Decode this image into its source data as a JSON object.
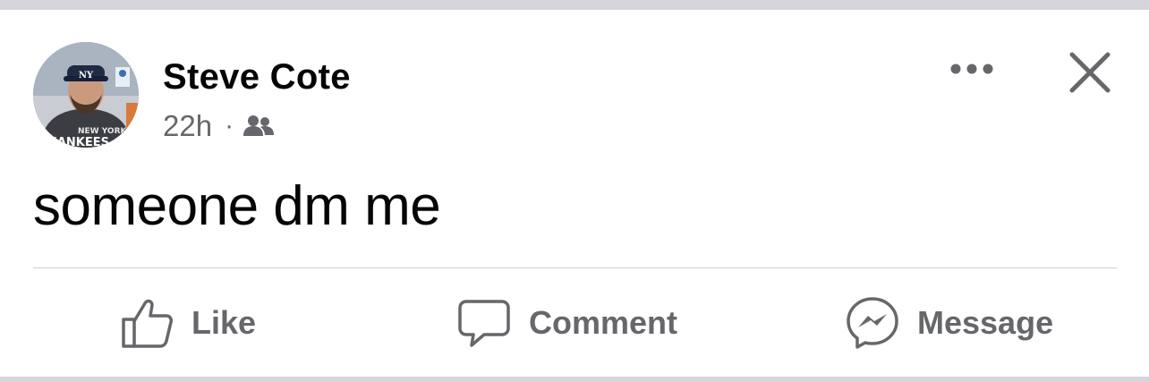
{
  "post": {
    "author_name": "Steve Cote",
    "timestamp": "22h",
    "separator": "·",
    "audience_icon": "friends-icon",
    "text": "someone dm me"
  },
  "header_actions": {
    "more_icon": "more-dots-icon",
    "close_icon": "close-icon"
  },
  "actions": {
    "like_label": "Like",
    "comment_label": "Comment",
    "message_label": "Message"
  },
  "colors": {
    "primary_text": "#050505",
    "secondary_text": "#65676b",
    "divider": "#ced0d4",
    "background": "#ffffff",
    "frame": "#d7d5dc"
  }
}
